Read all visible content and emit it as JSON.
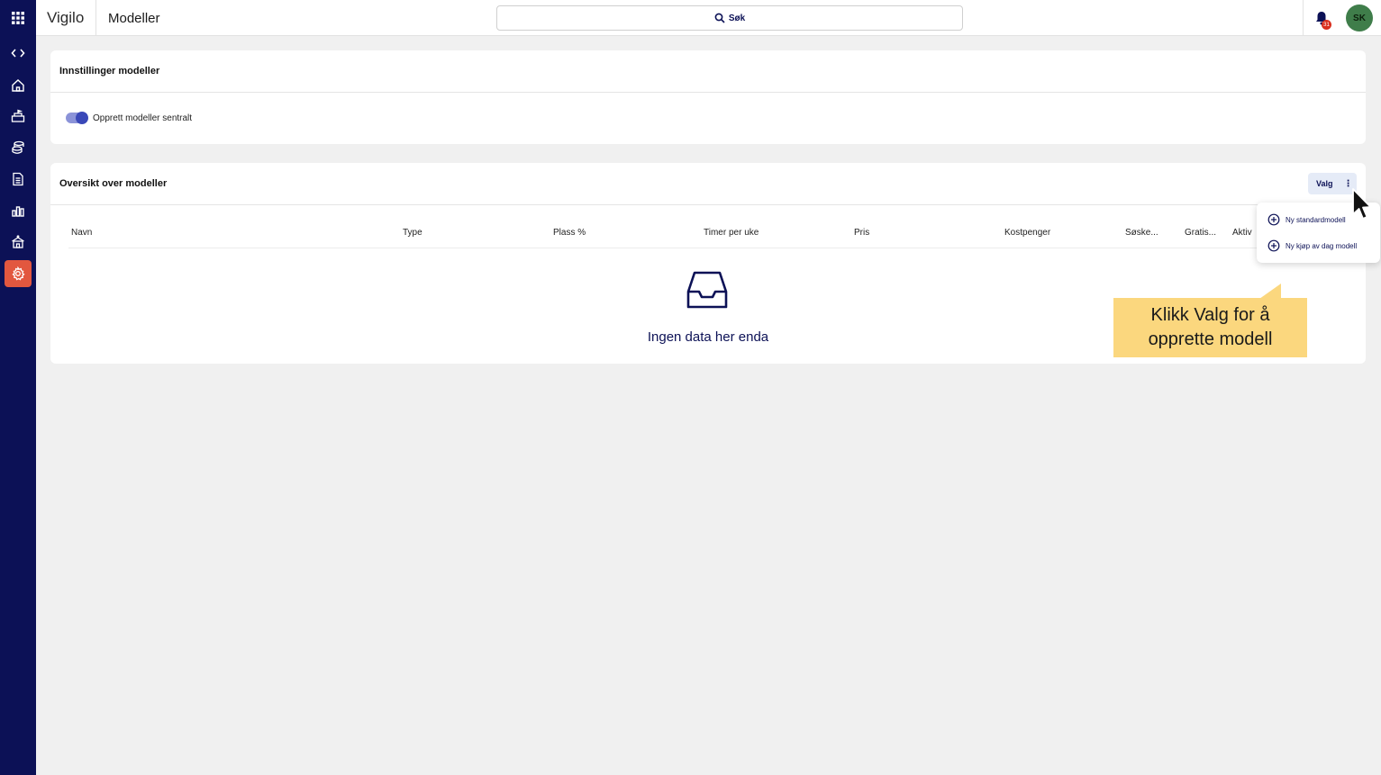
{
  "app": {
    "brand": "Vigilo",
    "page_title": "Modeller"
  },
  "search": {
    "label": "Søk"
  },
  "notifications": {
    "badge_count": "31"
  },
  "user": {
    "initials": "SK"
  },
  "sidebar": {
    "items": [
      {
        "icon": "grid-icon"
      },
      {
        "icon": "code-toggle-icon"
      },
      {
        "icon": "home-icon"
      },
      {
        "icon": "school-icon"
      },
      {
        "icon": "coins-icon"
      },
      {
        "icon": "document-icon"
      },
      {
        "icon": "bar-chart-icon"
      },
      {
        "icon": "building-icon"
      },
      {
        "icon": "gear-icon",
        "active": true
      }
    ]
  },
  "settings_card": {
    "title": "Innstillinger modeller",
    "toggle_label": "Opprett modeller sentralt",
    "toggle_on": true
  },
  "overview_card": {
    "title": "Oversikt over modeller",
    "valg_label": "Valg",
    "columns": [
      "Navn",
      "Type",
      "Plass %",
      "Timer per uke",
      "Pris",
      "Kostpenger",
      "Søske...",
      "Gratis...",
      "Aktiv"
    ],
    "empty_text": "Ingen data her enda"
  },
  "menu": {
    "items": [
      {
        "label": "Ny standardmodell"
      },
      {
        "label": "Ny kjøp av dag modell"
      }
    ]
  },
  "callout": {
    "text": "Klikk Valg for å opprette modell"
  },
  "colors": {
    "sidebar": "#0c1156",
    "accent": "#e2573f",
    "callout": "#fbd77e",
    "toggle": "#3a48b8"
  }
}
